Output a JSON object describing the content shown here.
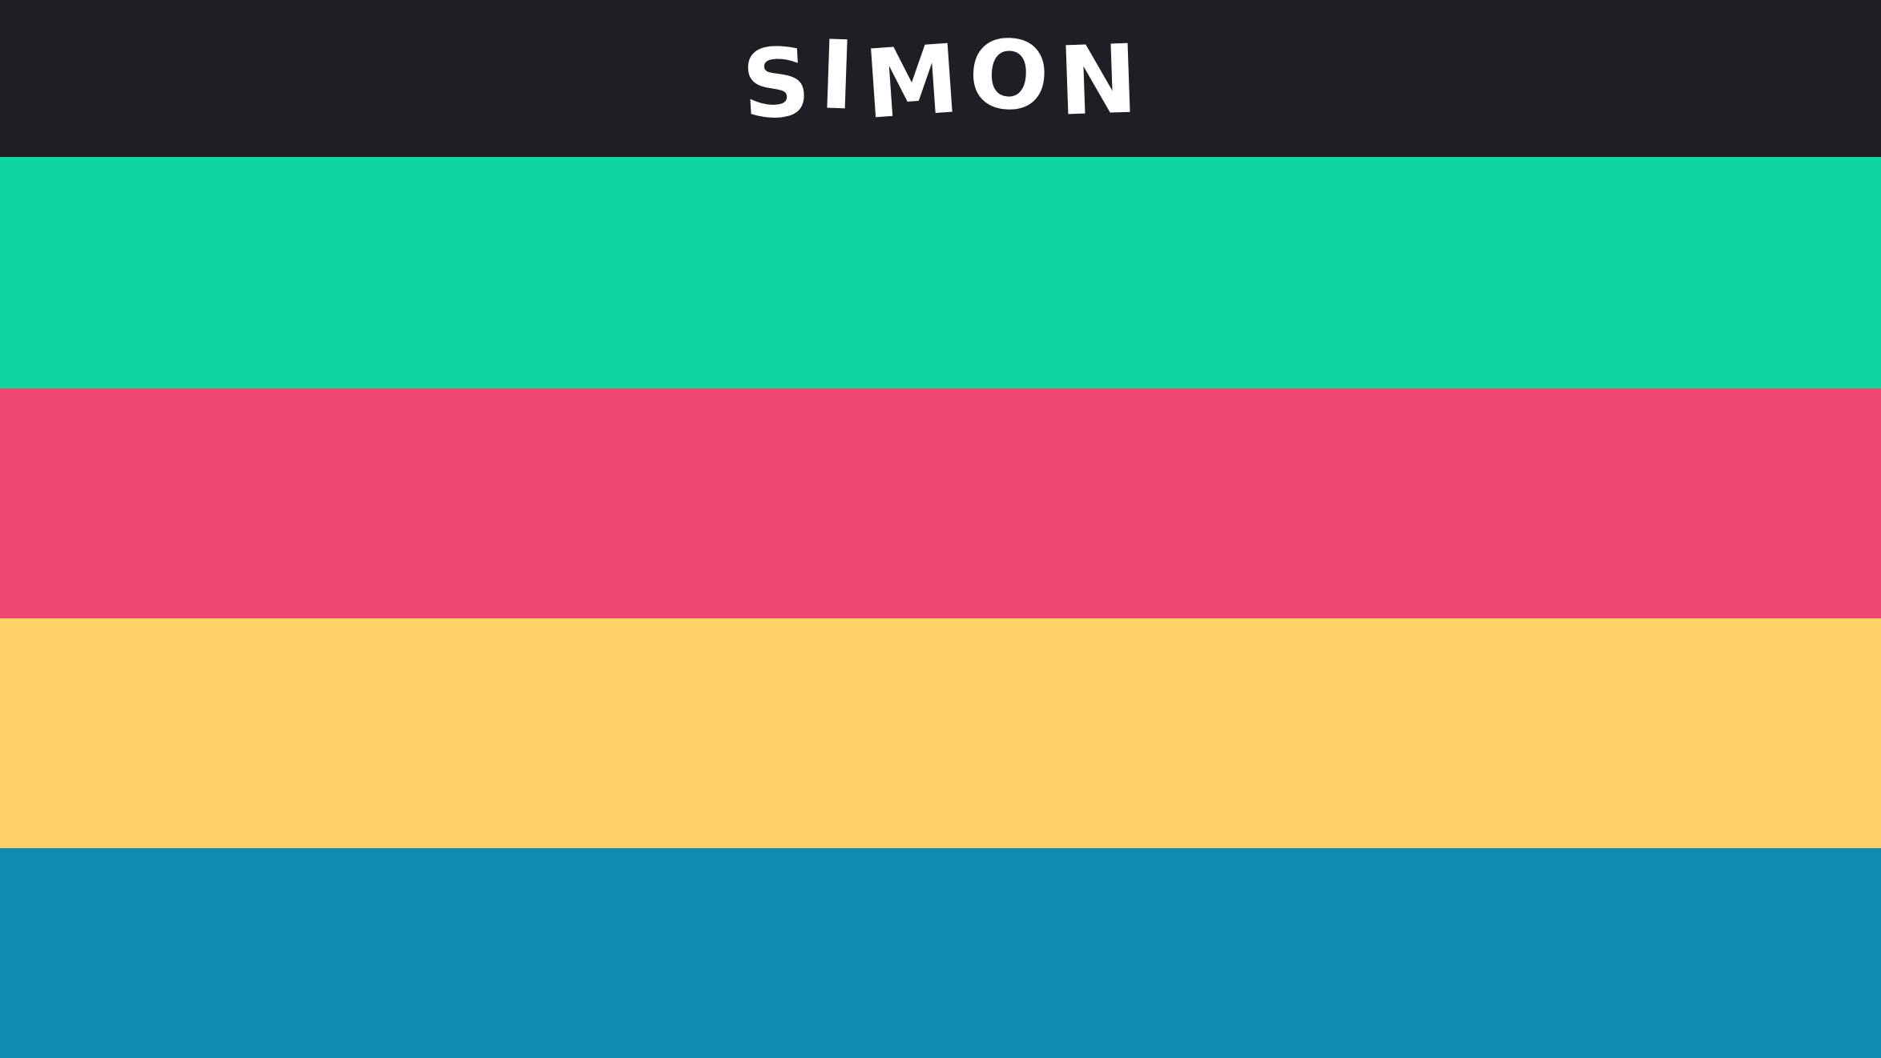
{
  "header": {
    "title_letters": [
      "S",
      "I",
      "M",
      "O",
      "N"
    ]
  },
  "pads": [
    {
      "name": "green",
      "color": "#0fd6a1"
    },
    {
      "name": "red",
      "color": "#ef476f"
    },
    {
      "name": "yellow",
      "color": "#ffd166"
    },
    {
      "name": "blue",
      "color": "#118ab2"
    }
  ],
  "theme": {
    "header_background": "#1e1e24",
    "title_color": "#ffffff"
  }
}
